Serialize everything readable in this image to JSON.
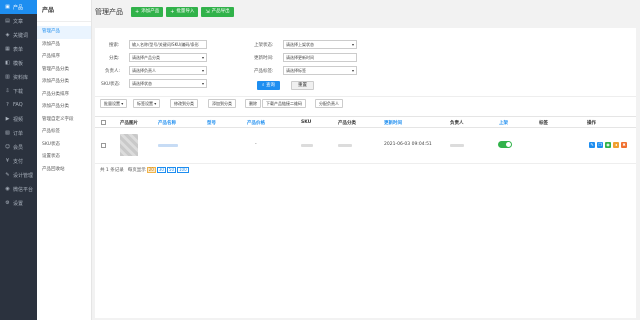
{
  "sidebar": {
    "items": [
      {
        "label": "产品",
        "icon": "product-icon",
        "active": true
      },
      {
        "label": "文章",
        "icon": "article-icon"
      },
      {
        "label": "关键词",
        "icon": "keyword-icon"
      },
      {
        "label": "表单",
        "icon": "form-icon"
      },
      {
        "label": "模板",
        "icon": "template-icon"
      },
      {
        "label": "资料库",
        "icon": "library-icon"
      },
      {
        "label": "下载",
        "icon": "download-icon"
      },
      {
        "label": "FAQ",
        "icon": "faq-icon"
      },
      {
        "label": "视频",
        "icon": "video-icon"
      },
      {
        "label": "订单",
        "icon": "order-icon"
      },
      {
        "label": "会员",
        "icon": "member-icon"
      },
      {
        "label": "支付",
        "icon": "payment-icon"
      },
      {
        "label": "设计管理",
        "icon": "design-icon"
      },
      {
        "label": "微信平台",
        "icon": "wechat-icon"
      },
      {
        "label": "设置",
        "icon": "settings-icon"
      }
    ]
  },
  "submenu": {
    "title": "产品",
    "items": [
      {
        "label": "管理产品",
        "active": true
      },
      {
        "label": "添加产品"
      },
      {
        "label": "产品排序"
      },
      {
        "label": "管理产品分类"
      },
      {
        "label": "添加产品分类"
      },
      {
        "label": "产品分类排序"
      },
      {
        "label": "添加产品分类"
      },
      {
        "label": "管理自定义字段"
      },
      {
        "label": "产品标签"
      },
      {
        "label": "SKU状态"
      },
      {
        "label": "设置状态"
      },
      {
        "label": "产品回收站"
      }
    ]
  },
  "header": {
    "title": "管理产品",
    "add_label": "添加产品",
    "import_label": "批量导入",
    "export_label": "产品导出"
  },
  "search": {
    "keyword_label": "搜索:",
    "keyword_value": "输入名称/型号/关键词/SKU/编码/条形",
    "category_label": "分类:",
    "category_value": "请选择产品分类",
    "owner_label": "负责人:",
    "owner_value": "请选择负责人",
    "sku_label": "SKU状态:",
    "sku_value": "请选择状态",
    "listing_label": "上架状态:",
    "listing_value": "请选择上架状态",
    "time_label": "更新时间:",
    "time_value": "请选择更新时间",
    "tag_label": "产品标签:",
    "tag_value": "请选择标签",
    "query_label": "查询",
    "reset_label": "重置"
  },
  "actions": {
    "batch_label": "批量设置",
    "tag_label": "标签设置",
    "category_label": "修改到分类",
    "add_category_label": "添加到分类",
    "delete_label": "删除",
    "qr_label": "下载产品链接二维码",
    "assign_label": "分配负责人"
  },
  "table": {
    "headers": {
      "image": "产品图片",
      "name": "产品名称",
      "model": "型号",
      "price": "产品价格",
      "sku": "SKU",
      "category": "产品分类",
      "updated": "更新时间",
      "owner": "负责人",
      "listed": "上架",
      "tag": "标签",
      "ops": "操作"
    },
    "rows": [
      {
        "price": "-",
        "updated": "2021-06-03 09:04:51",
        "listed": true
      }
    ]
  },
  "pager": {
    "total_text": "共 1 条记录",
    "per_page_text": "每页显示",
    "sizes": [
      "20",
      "30",
      "50",
      "100"
    ],
    "active_size": "20"
  },
  "colors": {
    "primary": "#1e8ef0",
    "green": "#31b24a",
    "sidebar_bg": "#2b323e"
  }
}
